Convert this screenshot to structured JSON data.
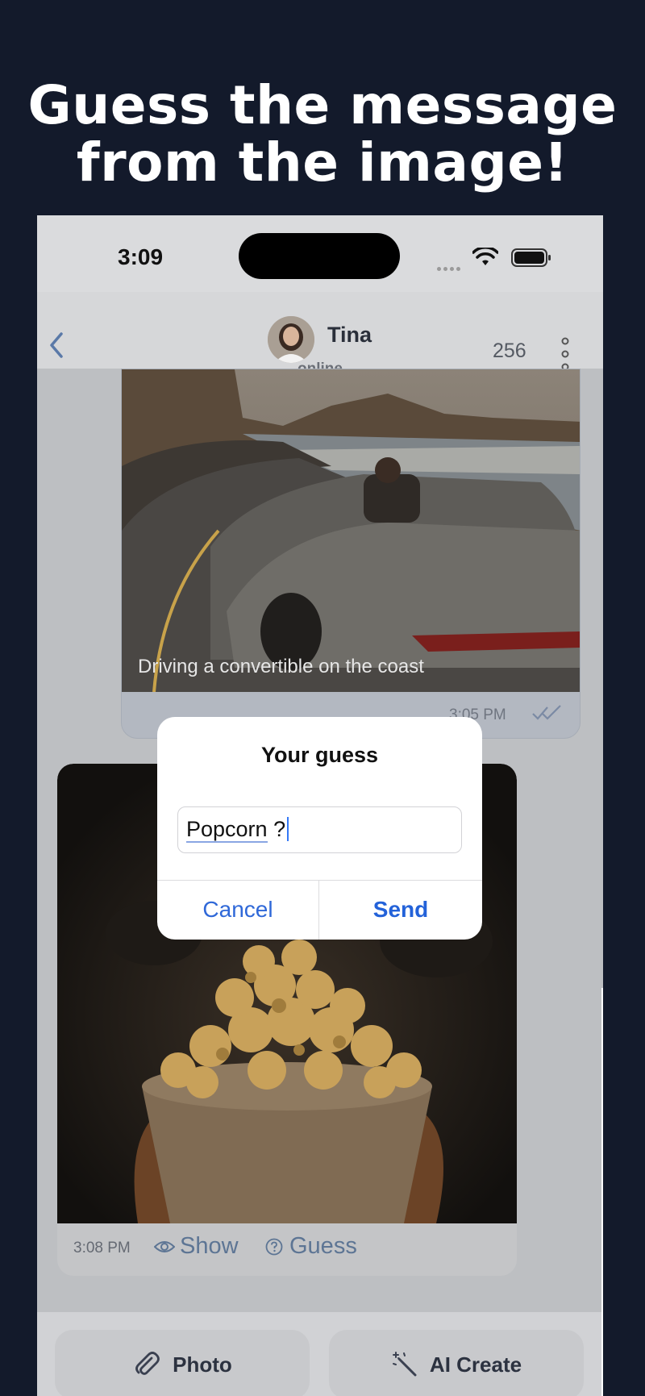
{
  "headline": {
    "line1": "Guess the message",
    "line2": "from the image!"
  },
  "status_bar": {
    "time": "3:09",
    "icons": [
      "signal-icon",
      "wifi-icon",
      "battery-icon"
    ]
  },
  "header": {
    "back_icon": "chevron-left-icon",
    "contact_name": "Tina",
    "contact_status": "online",
    "score": "256",
    "menu_icon": "more-vertical-icon"
  },
  "messages": {
    "outgoing": {
      "caption": "Driving a convertible on the coast",
      "time": "3:05 PM",
      "status_icon": "double-check-icon"
    },
    "incoming": {
      "time": "3:08 PM",
      "show_label": "Show",
      "guess_label": "Guess"
    }
  },
  "dialog": {
    "title": "Your guess",
    "input_word": "Popcorn",
    "input_rest": " ?",
    "cancel_label": "Cancel",
    "send_label": "Send"
  },
  "bottom_bar": {
    "photo_label": "Photo",
    "ai_label": "AI Create"
  },
  "colors": {
    "background": "#131a2b",
    "accent": "#2362d9",
    "overlay_text": "#5d7594"
  }
}
